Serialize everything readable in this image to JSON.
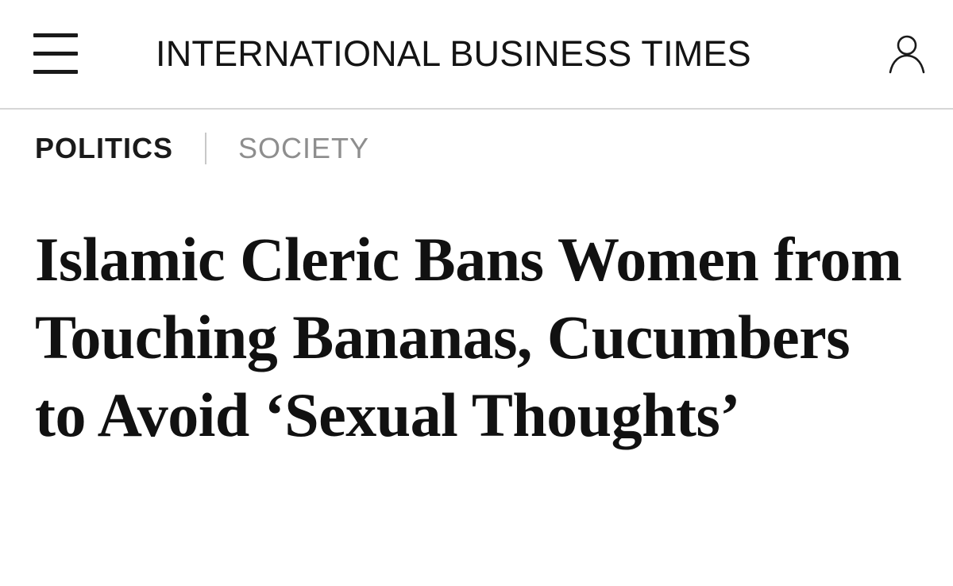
{
  "header": {
    "menu_icon": "hamburger-menu-icon",
    "site_title": "INTERNATIONAL BUSINESS TIMES",
    "account_icon": "user-account-icon"
  },
  "categories": {
    "primary": "POLITICS",
    "secondary": "SOCIETY"
  },
  "article": {
    "headline": "Islamic Cleric Bans Women from Touching Bananas, Cucumbers to Avoid ‘Sexual Thoughts’"
  },
  "colors": {
    "text": "#111111",
    "muted_category": "#8e8e8e",
    "divider": "#d6d6d6",
    "background": "#ffffff"
  }
}
